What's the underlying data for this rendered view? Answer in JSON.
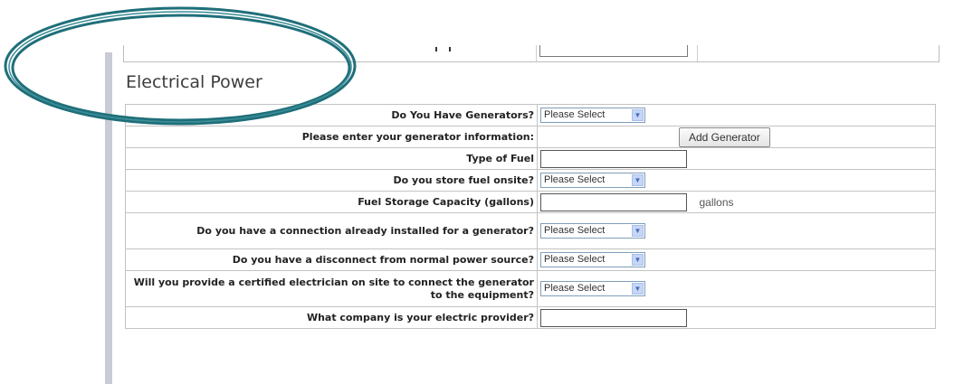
{
  "section": {
    "title": "Electrical Power"
  },
  "form": {
    "rows": [
      {
        "label": "Do You Have Generators?",
        "control": "select",
        "value": "Please Select"
      },
      {
        "label": "Please enter your generator information:",
        "control": "button",
        "value": "Add Generator"
      },
      {
        "label": "Type of Fuel",
        "control": "text",
        "value": ""
      },
      {
        "label": "Do you store fuel onsite?",
        "control": "select",
        "value": "Please Select"
      },
      {
        "label": "Fuel Storage Capacity (gallons)",
        "control": "text-unit",
        "value": "",
        "unit": "gallons"
      },
      {
        "label": "Do you have a connection already installed for a generator?",
        "control": "select",
        "value": "Please Select"
      },
      {
        "label": "Do you have a disconnect from normal power source?",
        "control": "select",
        "value": "Please Select"
      },
      {
        "label": "Will you provide a certified electrician on site to connect the generator to the equipment?",
        "control": "select",
        "value": "Please Select"
      },
      {
        "label": "What company is your electric provider?",
        "control": "text",
        "value": ""
      }
    ]
  },
  "icons": {
    "dropdown": "chevron-down-icon"
  },
  "colors": {
    "ellipse": "#1f6f7a",
    "select_border": "#7f9db9",
    "arrow_bg": "#c5d6f7"
  }
}
